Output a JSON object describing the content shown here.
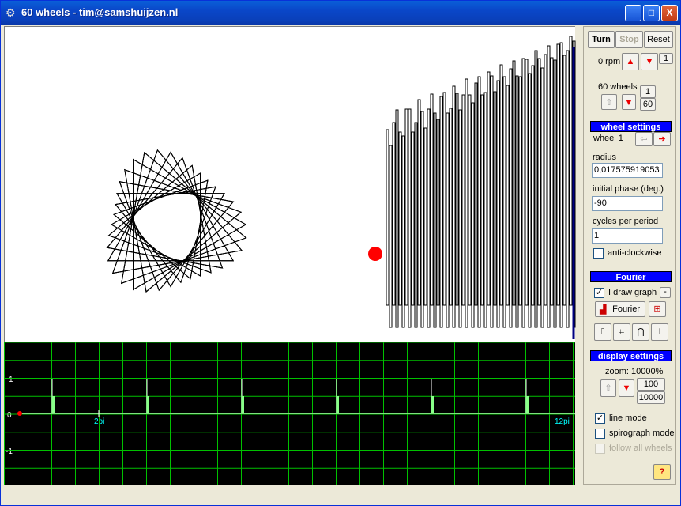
{
  "window": {
    "title": "60 wheels - tim@samshuijzen.nl",
    "minimize": "_",
    "maximize": "□",
    "close": "X"
  },
  "controls": {
    "turn": "Turn",
    "stop": "Stop",
    "reset": "Reset",
    "rpm": "0 rpm",
    "rpm_step": "1",
    "wheels": "60 wheels",
    "wheels_min": "1",
    "wheels_max": "60"
  },
  "wheel_settings": {
    "header": "wheel settings",
    "wheel": "wheel 1",
    "radius_label": "radius",
    "radius_value": "0,017575919053",
    "phase_label": "initial phase (deg.)",
    "phase_value": "-90",
    "cycles_label": "cycles per period",
    "cycles_value": "1",
    "anticlockwise_label": "anti-clockwise"
  },
  "fourier": {
    "header": "Fourier",
    "draw_graph_label": "I draw graph",
    "draw_graph_checked": "✓",
    "side_button": "-",
    "fourier_button": "Fourier"
  },
  "display_settings": {
    "header": "display settings",
    "zoom": "zoom: 10000%",
    "zoom_100": "100",
    "zoom_10000": "10000",
    "line_mode": "line mode",
    "line_mode_checked": "✓",
    "spirograph_mode": "spirograph mode",
    "follow_all_wheels": "follow all wheels",
    "help": "?"
  },
  "graph": {
    "label_1": "1",
    "label_0": "0",
    "label_m1": "-1",
    "label_2pi": "2pi",
    "label_12pi": "12pi"
  },
  "colors": {
    "grid": "#00c000",
    "dot": "#ff0000",
    "axis_label": "#00ffff",
    "accent": "#0000ff"
  }
}
